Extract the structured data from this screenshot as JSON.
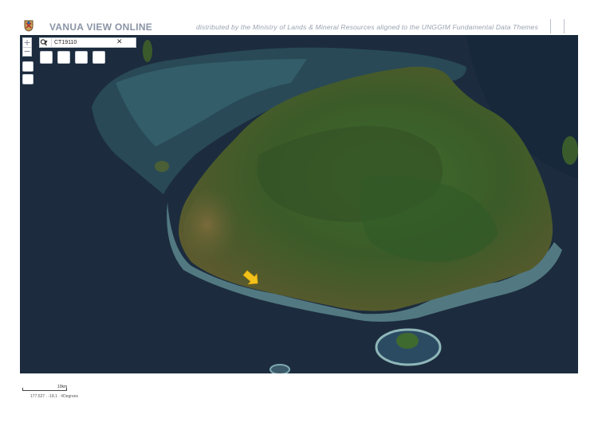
{
  "header": {
    "title": "VANUA VIEW ONLINE",
    "subtitle": "distributed by the Ministry of Lands & Mineral Resources aligned to the UNGGIM Fundamental Data Themes"
  },
  "search": {
    "value": "CT19110"
  },
  "map": {
    "basemap": "satellite-imagery",
    "marker_icon": "arrow-marker-icon",
    "marker_color": "#f2c21b"
  },
  "footer": {
    "scale_label": "10km",
    "coordinates": "177.527 · -18.1 ·  #Degrees"
  },
  "colors": {
    "title": "#8a94a6",
    "ocean": "#1c2c3e",
    "land": "#3d5a2a"
  }
}
